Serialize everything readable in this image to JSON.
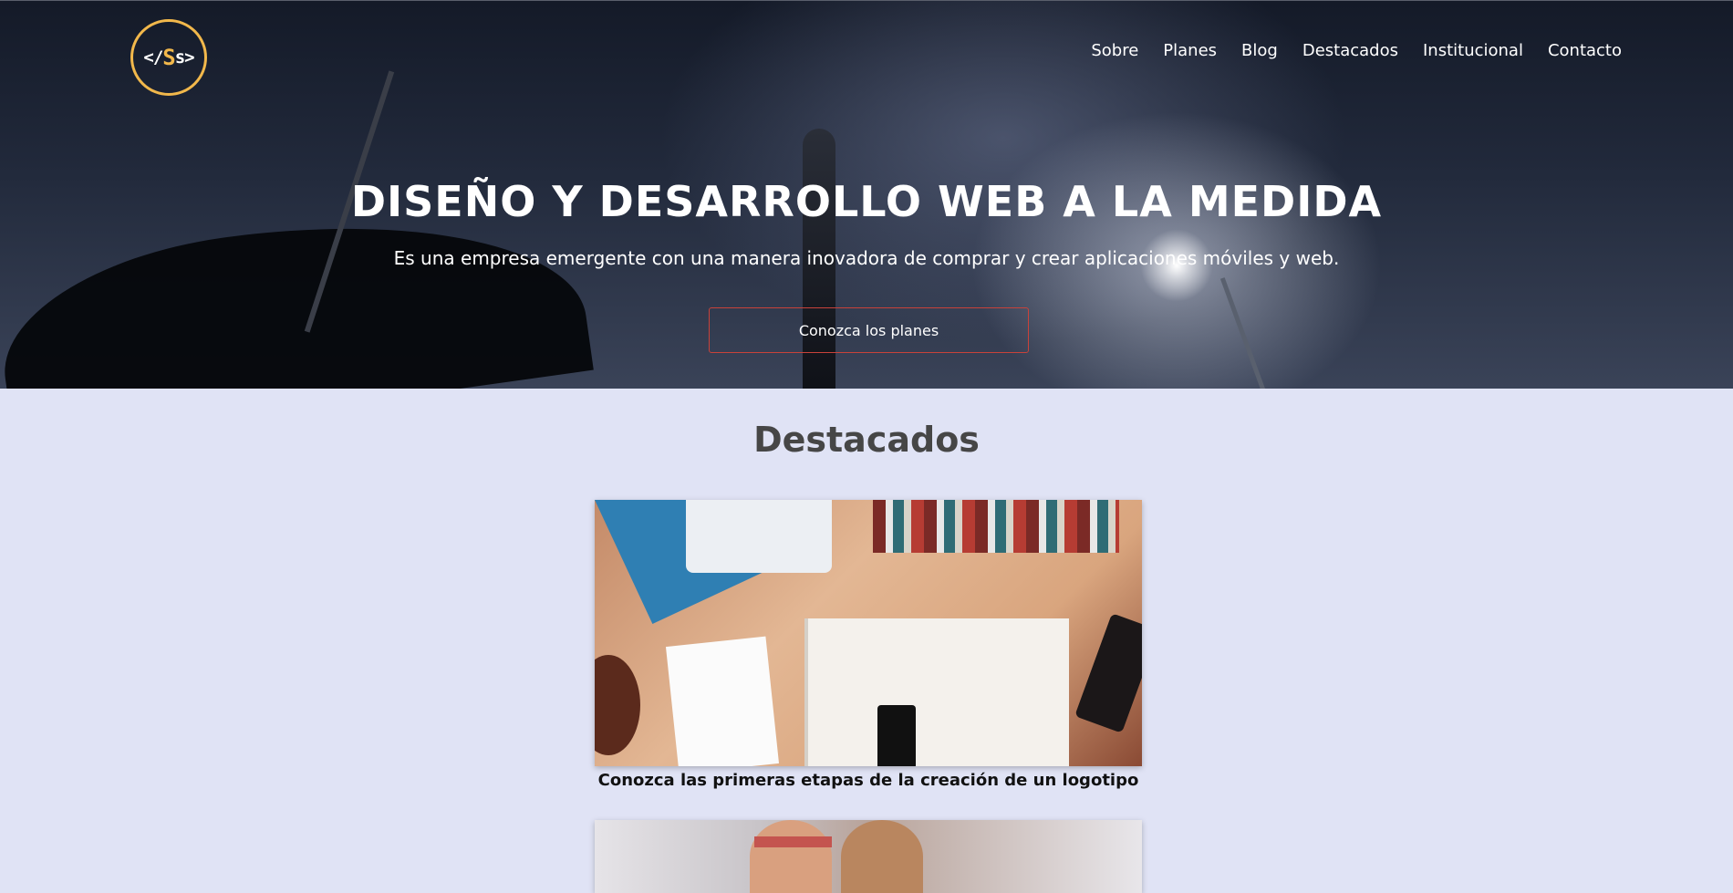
{
  "brand": {
    "logo_text_left": "</",
    "logo_text_accent": "S",
    "logo_text_right": "s>",
    "accent_color": "#f2b84b"
  },
  "nav": {
    "items": [
      {
        "label": "Sobre"
      },
      {
        "label": "Planes"
      },
      {
        "label": "Blog"
      },
      {
        "label": "Destacados"
      },
      {
        "label": "Institucional"
      },
      {
        "label": "Contacto"
      }
    ]
  },
  "hero": {
    "title": "DISEÑO Y DESARROLLO WEB A LA MEDIDA",
    "subtitle": "Es una empresa emergente con una manera inovadora de comprar y crear aplicaciones móviles y web.",
    "cta_label": "Conozca los planes",
    "cta_border_color": "#c8423a"
  },
  "featured": {
    "title": "Destacados",
    "cards": [
      {
        "caption": "Conozca las primeras etapas de la creación de un logotipo"
      },
      {
        "caption": ""
      }
    ]
  },
  "colors": {
    "page_background": "#e0e3f5",
    "heading_color": "#464646"
  }
}
